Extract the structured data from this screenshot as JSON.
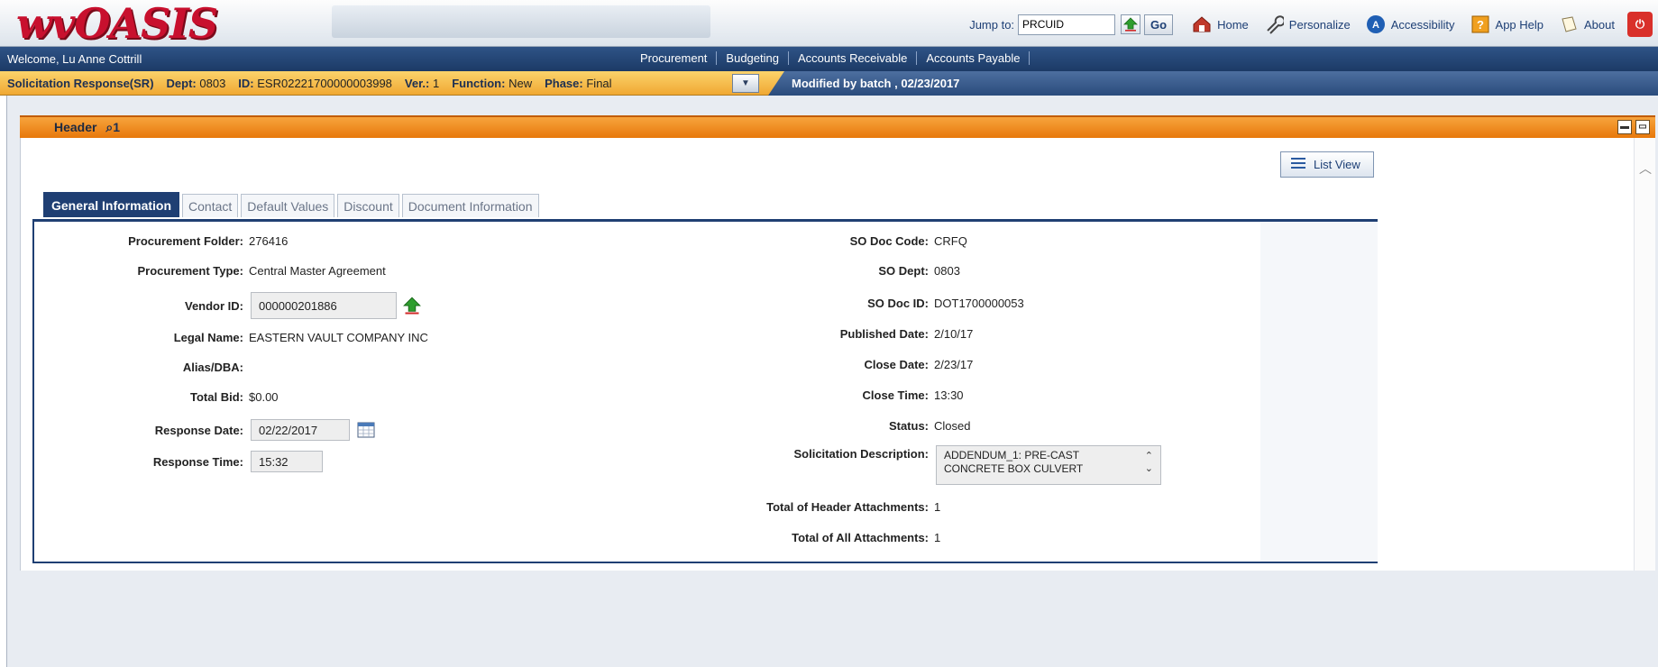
{
  "app": {
    "logo_text": "wvOASIS"
  },
  "toolbar": {
    "jump_label": "Jump to:",
    "jump_value": "PRCUID",
    "go_label": "Go",
    "home": "Home",
    "personalize": "Personalize",
    "accessibility": "Accessibility",
    "app_help": "App Help",
    "about": "About"
  },
  "nav": {
    "welcome": "Welcome, Lu Anne Cottrill",
    "modules": [
      "Procurement",
      "Budgeting",
      "Accounts Receivable",
      "Accounts Payable"
    ]
  },
  "docbar": {
    "doc_type": "Solicitation Response(SR)",
    "dept_label": "Dept:",
    "dept_value": "0803",
    "id_label": "ID:",
    "id_value": "ESR02221700000003998",
    "ver_label": "Ver.:",
    "ver_value": "1",
    "function_label": "Function:",
    "function_value": "New",
    "phase_label": "Phase:",
    "phase_value": "Final",
    "modified_text": "Modified by batch , 02/23/2017"
  },
  "panel": {
    "title": "Header",
    "attachment_count": "1",
    "list_view_label": "List View"
  },
  "tabs": [
    "General Information",
    "Contact",
    "Default Values",
    "Discount",
    "Document Information"
  ],
  "left_fields": {
    "procurement_folder": {
      "label": "Procurement Folder:",
      "value": "276416"
    },
    "procurement_type": {
      "label": "Procurement Type:",
      "value": "Central Master Agreement"
    },
    "vendor_id": {
      "label": "Vendor ID:",
      "value": "000000201886"
    },
    "legal_name": {
      "label": "Legal Name:",
      "value": "EASTERN VAULT COMPANY INC"
    },
    "alias": {
      "label": "Alias/DBA:",
      "value": ""
    },
    "total_bid": {
      "label": "Total Bid:",
      "value": "$0.00"
    },
    "response_date": {
      "label": "Response Date:",
      "value": "02/22/2017"
    },
    "response_time": {
      "label": "Response Time:",
      "value": "15:32"
    }
  },
  "right_fields": {
    "so_doc_code": {
      "label": "SO Doc Code:",
      "value": "CRFQ"
    },
    "so_dept": {
      "label": "SO Dept:",
      "value": "0803"
    },
    "so_doc_id": {
      "label": "SO Doc ID:",
      "value": "DOT1700000053"
    },
    "published_date": {
      "label": "Published Date:",
      "value": "2/10/17"
    },
    "close_date": {
      "label": "Close Date:",
      "value": "2/23/17"
    },
    "close_time": {
      "label": "Close Time:",
      "value": "13:30"
    },
    "status": {
      "label": "Status:",
      "value": "Closed"
    },
    "solicitation_description": {
      "label": "Solicitation Description:",
      "line1": "ADDENDUM_1: PRE-CAST",
      "line2": "CONCRETE BOX CULVERT"
    },
    "total_header_attachments": {
      "label": "Total of Header Attachments:",
      "value": "1"
    },
    "total_all_attachments": {
      "label": "Total of All Attachments:",
      "value": "1"
    }
  }
}
